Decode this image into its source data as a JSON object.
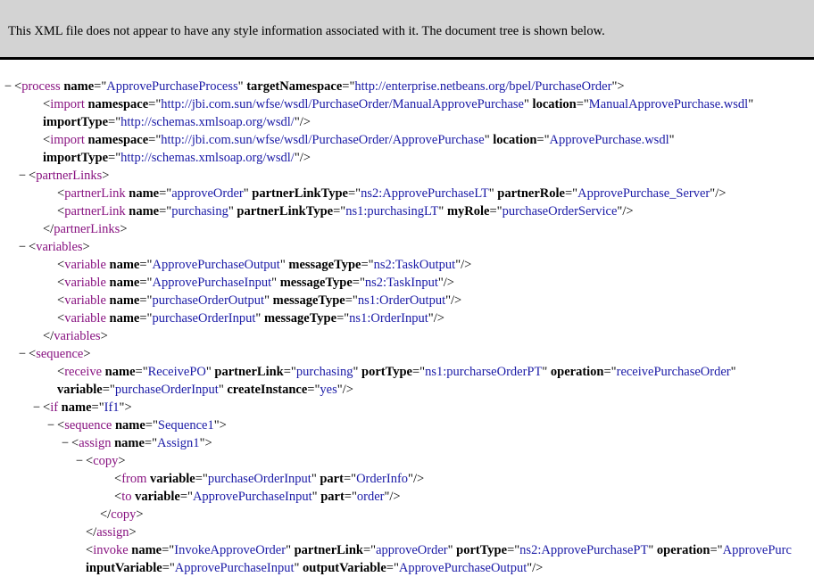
{
  "banner": "This XML file does not appear to have any style information associated with it. The document tree is shown below.",
  "toggle_symbol": "−",
  "lines": [
    {
      "indent": 0,
      "toggle": true,
      "parts": [
        [
          "br",
          "<"
        ],
        [
          "tag",
          "process"
        ],
        [
          "sp",
          " "
        ],
        [
          "an",
          "name"
        ],
        [
          "eq",
          "=\""
        ],
        [
          "av",
          "ApprovePurchaseProcess"
        ],
        [
          "eq",
          "\""
        ],
        [
          "sp",
          " "
        ],
        [
          "an",
          "targetNamespace"
        ],
        [
          "eq",
          "=\""
        ],
        [
          "av",
          "http://enterprise.netbeans.org/bpel/PurchaseOrder"
        ],
        [
          "eq",
          "\""
        ],
        [
          "br",
          ">"
        ]
      ]
    },
    {
      "indent": 2,
      "toggle": false,
      "parts": [
        [
          "br",
          "<"
        ],
        [
          "tag",
          "import"
        ],
        [
          "sp",
          " "
        ],
        [
          "an",
          "namespace"
        ],
        [
          "eq",
          "=\""
        ],
        [
          "av",
          "http://jbi.com.sun/wfse/wsdl/PurchaseOrder/ManualApprovePurchase"
        ],
        [
          "eq",
          "\""
        ],
        [
          "sp",
          " "
        ],
        [
          "an",
          "location"
        ],
        [
          "eq",
          "=\""
        ],
        [
          "av",
          "ManualApprovePurchase.wsdl"
        ],
        [
          "eq",
          "\""
        ]
      ]
    },
    {
      "indent": 2,
      "toggle": false,
      "parts": [
        [
          "an",
          "importType"
        ],
        [
          "eq",
          "=\""
        ],
        [
          "av",
          "http://schemas.xmlsoap.org/wsdl/"
        ],
        [
          "eq",
          "\""
        ],
        [
          "br",
          "/>"
        ]
      ]
    },
    {
      "indent": 2,
      "toggle": false,
      "parts": [
        [
          "br",
          "<"
        ],
        [
          "tag",
          "import"
        ],
        [
          "sp",
          " "
        ],
        [
          "an",
          "namespace"
        ],
        [
          "eq",
          "=\""
        ],
        [
          "av",
          "http://jbi.com.sun/wfse/wsdl/PurchaseOrder/ApprovePurchase"
        ],
        [
          "eq",
          "\""
        ],
        [
          "sp",
          " "
        ],
        [
          "an",
          "location"
        ],
        [
          "eq",
          "=\""
        ],
        [
          "av",
          "ApprovePurchase.wsdl"
        ],
        [
          "eq",
          "\""
        ]
      ]
    },
    {
      "indent": 2,
      "toggle": false,
      "parts": [
        [
          "an",
          "importType"
        ],
        [
          "eq",
          "=\""
        ],
        [
          "av",
          "http://schemas.xmlsoap.org/wsdl/"
        ],
        [
          "eq",
          "\""
        ],
        [
          "br",
          "/>"
        ]
      ]
    },
    {
      "indent": 1,
      "toggle": true,
      "parts": [
        [
          "br",
          "<"
        ],
        [
          "tag",
          "partnerLinks"
        ],
        [
          "br",
          ">"
        ]
      ]
    },
    {
      "indent": 3,
      "toggle": false,
      "parts": [
        [
          "br",
          "<"
        ],
        [
          "tag",
          "partnerLink"
        ],
        [
          "sp",
          " "
        ],
        [
          "an",
          "name"
        ],
        [
          "eq",
          "=\""
        ],
        [
          "av",
          "approveOrder"
        ],
        [
          "eq",
          "\""
        ],
        [
          "sp",
          " "
        ],
        [
          "an",
          "partnerLinkType"
        ],
        [
          "eq",
          "=\""
        ],
        [
          "av",
          "ns2:ApprovePurchaseLT"
        ],
        [
          "eq",
          "\""
        ],
        [
          "sp",
          " "
        ],
        [
          "an",
          "partnerRole"
        ],
        [
          "eq",
          "=\""
        ],
        [
          "av",
          "ApprovePurchase_Server"
        ],
        [
          "eq",
          "\""
        ],
        [
          "br",
          "/>"
        ]
      ]
    },
    {
      "indent": 3,
      "toggle": false,
      "parts": [
        [
          "br",
          "<"
        ],
        [
          "tag",
          "partnerLink"
        ],
        [
          "sp",
          " "
        ],
        [
          "an",
          "name"
        ],
        [
          "eq",
          "=\""
        ],
        [
          "av",
          "purchasing"
        ],
        [
          "eq",
          "\""
        ],
        [
          "sp",
          " "
        ],
        [
          "an",
          "partnerLinkType"
        ],
        [
          "eq",
          "=\""
        ],
        [
          "av",
          "ns1:purchasingLT"
        ],
        [
          "eq",
          "\""
        ],
        [
          "sp",
          " "
        ],
        [
          "an",
          "myRole"
        ],
        [
          "eq",
          "=\""
        ],
        [
          "av",
          "purchaseOrderService"
        ],
        [
          "eq",
          "\""
        ],
        [
          "br",
          "/>"
        ]
      ]
    },
    {
      "indent": 2,
      "toggle": false,
      "parts": [
        [
          "br",
          "</"
        ],
        [
          "tag",
          "partnerLinks"
        ],
        [
          "br",
          ">"
        ]
      ]
    },
    {
      "indent": 1,
      "toggle": true,
      "parts": [
        [
          "br",
          "<"
        ],
        [
          "tag",
          "variables"
        ],
        [
          "br",
          ">"
        ]
      ]
    },
    {
      "indent": 3,
      "toggle": false,
      "parts": [
        [
          "br",
          "<"
        ],
        [
          "tag",
          "variable"
        ],
        [
          "sp",
          " "
        ],
        [
          "an",
          "name"
        ],
        [
          "eq",
          "=\""
        ],
        [
          "av",
          "ApprovePurchaseOutput"
        ],
        [
          "eq",
          "\""
        ],
        [
          "sp",
          " "
        ],
        [
          "an",
          "messageType"
        ],
        [
          "eq",
          "=\""
        ],
        [
          "av",
          "ns2:TaskOutput"
        ],
        [
          "eq",
          "\""
        ],
        [
          "br",
          "/>"
        ]
      ]
    },
    {
      "indent": 3,
      "toggle": false,
      "parts": [
        [
          "br",
          "<"
        ],
        [
          "tag",
          "variable"
        ],
        [
          "sp",
          " "
        ],
        [
          "an",
          "name"
        ],
        [
          "eq",
          "=\""
        ],
        [
          "av",
          "ApprovePurchaseInput"
        ],
        [
          "eq",
          "\""
        ],
        [
          "sp",
          " "
        ],
        [
          "an",
          "messageType"
        ],
        [
          "eq",
          "=\""
        ],
        [
          "av",
          "ns2:TaskInput"
        ],
        [
          "eq",
          "\""
        ],
        [
          "br",
          "/>"
        ]
      ]
    },
    {
      "indent": 3,
      "toggle": false,
      "parts": [
        [
          "br",
          "<"
        ],
        [
          "tag",
          "variable"
        ],
        [
          "sp",
          " "
        ],
        [
          "an",
          "name"
        ],
        [
          "eq",
          "=\""
        ],
        [
          "av",
          "purchaseOrderOutput"
        ],
        [
          "eq",
          "\""
        ],
        [
          "sp",
          " "
        ],
        [
          "an",
          "messageType"
        ],
        [
          "eq",
          "=\""
        ],
        [
          "av",
          "ns1:OrderOutput"
        ],
        [
          "eq",
          "\""
        ],
        [
          "br",
          "/>"
        ]
      ]
    },
    {
      "indent": 3,
      "toggle": false,
      "parts": [
        [
          "br",
          "<"
        ],
        [
          "tag",
          "variable"
        ],
        [
          "sp",
          " "
        ],
        [
          "an",
          "name"
        ],
        [
          "eq",
          "=\""
        ],
        [
          "av",
          "purchaseOrderInput"
        ],
        [
          "eq",
          "\""
        ],
        [
          "sp",
          " "
        ],
        [
          "an",
          "messageType"
        ],
        [
          "eq",
          "=\""
        ],
        [
          "av",
          "ns1:OrderInput"
        ],
        [
          "eq",
          "\""
        ],
        [
          "br",
          "/>"
        ]
      ]
    },
    {
      "indent": 2,
      "toggle": false,
      "parts": [
        [
          "br",
          "</"
        ],
        [
          "tag",
          "variables"
        ],
        [
          "br",
          ">"
        ]
      ]
    },
    {
      "indent": 1,
      "toggle": true,
      "parts": [
        [
          "br",
          "<"
        ],
        [
          "tag",
          "sequence"
        ],
        [
          "br",
          ">"
        ]
      ]
    },
    {
      "indent": 3,
      "toggle": false,
      "parts": [
        [
          "br",
          "<"
        ],
        [
          "tag",
          "receive"
        ],
        [
          "sp",
          " "
        ],
        [
          "an",
          "name"
        ],
        [
          "eq",
          "=\""
        ],
        [
          "av",
          "ReceivePO"
        ],
        [
          "eq",
          "\""
        ],
        [
          "sp",
          " "
        ],
        [
          "an",
          "partnerLink"
        ],
        [
          "eq",
          "=\""
        ],
        [
          "av",
          "purchasing"
        ],
        [
          "eq",
          "\""
        ],
        [
          "sp",
          " "
        ],
        [
          "an",
          "portType"
        ],
        [
          "eq",
          "=\""
        ],
        [
          "av",
          "ns1:purcharseOrderPT"
        ],
        [
          "eq",
          "\""
        ],
        [
          "sp",
          " "
        ],
        [
          "an",
          "operation"
        ],
        [
          "eq",
          "=\""
        ],
        [
          "av",
          "receivePurchaseOrder"
        ],
        [
          "eq",
          "\""
        ]
      ]
    },
    {
      "indent": 3,
      "toggle": false,
      "parts": [
        [
          "an",
          "variable"
        ],
        [
          "eq",
          "=\""
        ],
        [
          "av",
          "purchaseOrderInput"
        ],
        [
          "eq",
          "\""
        ],
        [
          "sp",
          " "
        ],
        [
          "an",
          "createInstance"
        ],
        [
          "eq",
          "=\""
        ],
        [
          "av",
          "yes"
        ],
        [
          "eq",
          "\""
        ],
        [
          "br",
          "/>"
        ]
      ]
    },
    {
      "indent": 2,
      "toggle": true,
      "parts": [
        [
          "br",
          "<"
        ],
        [
          "tag",
          "if"
        ],
        [
          "sp",
          " "
        ],
        [
          "an",
          "name"
        ],
        [
          "eq",
          "=\""
        ],
        [
          "av",
          "If1"
        ],
        [
          "eq",
          "\""
        ],
        [
          "br",
          ">"
        ]
      ]
    },
    {
      "indent": 3,
      "toggle": true,
      "parts": [
        [
          "br",
          "<"
        ],
        [
          "tag",
          "sequence"
        ],
        [
          "sp",
          " "
        ],
        [
          "an",
          "name"
        ],
        [
          "eq",
          "=\""
        ],
        [
          "av",
          "Sequence1"
        ],
        [
          "eq",
          "\""
        ],
        [
          "br",
          ">"
        ]
      ]
    },
    {
      "indent": 4,
      "toggle": true,
      "parts": [
        [
          "br",
          "<"
        ],
        [
          "tag",
          "assign"
        ],
        [
          "sp",
          " "
        ],
        [
          "an",
          "name"
        ],
        [
          "eq",
          "=\""
        ],
        [
          "av",
          "Assign1"
        ],
        [
          "eq",
          "\""
        ],
        [
          "br",
          ">"
        ]
      ]
    },
    {
      "indent": 5,
      "toggle": true,
      "parts": [
        [
          "br",
          "<"
        ],
        [
          "tag",
          "copy"
        ],
        [
          "br",
          ">"
        ]
      ]
    },
    {
      "indent": 7,
      "toggle": false,
      "parts": [
        [
          "br",
          "<"
        ],
        [
          "tag",
          "from"
        ],
        [
          "sp",
          " "
        ],
        [
          "an",
          "variable"
        ],
        [
          "eq",
          "=\""
        ],
        [
          "av",
          "purchaseOrderInput"
        ],
        [
          "eq",
          "\""
        ],
        [
          "sp",
          " "
        ],
        [
          "an",
          "part"
        ],
        [
          "eq",
          "=\""
        ],
        [
          "av",
          "OrderInfo"
        ],
        [
          "eq",
          "\""
        ],
        [
          "br",
          "/>"
        ]
      ]
    },
    {
      "indent": 7,
      "toggle": false,
      "parts": [
        [
          "br",
          "<"
        ],
        [
          "tag",
          "to"
        ],
        [
          "sp",
          " "
        ],
        [
          "an",
          "variable"
        ],
        [
          "eq",
          "=\""
        ],
        [
          "av",
          "ApprovePurchaseInput"
        ],
        [
          "eq",
          "\""
        ],
        [
          "sp",
          " "
        ],
        [
          "an",
          "part"
        ],
        [
          "eq",
          "=\""
        ],
        [
          "av",
          "order"
        ],
        [
          "eq",
          "\""
        ],
        [
          "br",
          "/>"
        ]
      ]
    },
    {
      "indent": 6,
      "toggle": false,
      "parts": [
        [
          "br",
          "</"
        ],
        [
          "tag",
          "copy"
        ],
        [
          "br",
          ">"
        ]
      ]
    },
    {
      "indent": 5,
      "toggle": false,
      "parts": [
        [
          "br",
          "</"
        ],
        [
          "tag",
          "assign"
        ],
        [
          "br",
          ">"
        ]
      ]
    },
    {
      "indent": 5,
      "toggle": false,
      "parts": [
        [
          "br",
          "<"
        ],
        [
          "tag",
          "invoke"
        ],
        [
          "sp",
          " "
        ],
        [
          "an",
          "name"
        ],
        [
          "eq",
          "=\""
        ],
        [
          "av",
          "InvokeApproveOrder"
        ],
        [
          "eq",
          "\""
        ],
        [
          "sp",
          " "
        ],
        [
          "an",
          "partnerLink"
        ],
        [
          "eq",
          "=\""
        ],
        [
          "av",
          "approveOrder"
        ],
        [
          "eq",
          "\""
        ],
        [
          "sp",
          " "
        ],
        [
          "an",
          "portType"
        ],
        [
          "eq",
          "=\""
        ],
        [
          "av",
          "ns2:ApprovePurchasePT"
        ],
        [
          "eq",
          "\""
        ],
        [
          "sp",
          " "
        ],
        [
          "an",
          "operation"
        ],
        [
          "eq",
          "=\""
        ],
        [
          "av",
          "ApprovePurc"
        ]
      ]
    },
    {
      "indent": 5,
      "toggle": false,
      "parts": [
        [
          "an",
          "inputVariable"
        ],
        [
          "eq",
          "=\""
        ],
        [
          "av",
          "ApprovePurchaseInput"
        ],
        [
          "eq",
          "\""
        ],
        [
          "sp",
          " "
        ],
        [
          "an",
          "outputVariable"
        ],
        [
          "eq",
          "=\""
        ],
        [
          "av",
          "ApprovePurchaseOutput"
        ],
        [
          "eq",
          "\""
        ],
        [
          "br",
          "/>"
        ]
      ]
    }
  ]
}
